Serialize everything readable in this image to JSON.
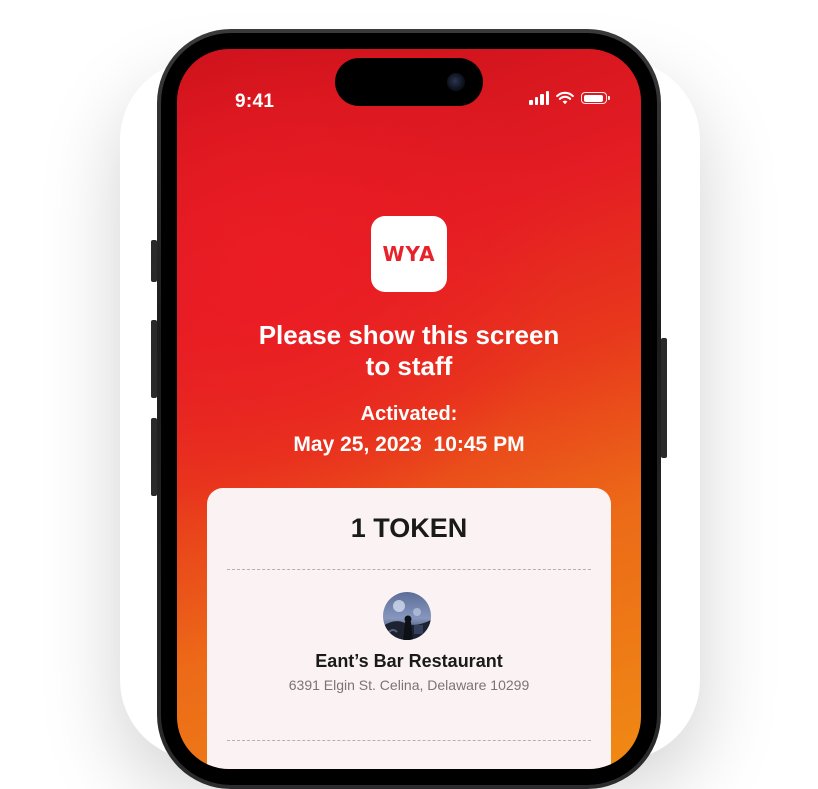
{
  "status_bar": {
    "time": "9:41",
    "signal_icon": "cellular-signal-icon",
    "wifi_icon": "wifi-icon",
    "battery_icon": "battery-icon"
  },
  "app": {
    "logo_text": "WYA",
    "brand_color": "#E8222A"
  },
  "main": {
    "heading_line1": "Please show this screen",
    "heading_line2": "to staff",
    "activated_label": "Activated:",
    "activated_date": "May 25, 2023  10:45 PM"
  },
  "card": {
    "token_label": "1 TOKEN",
    "venue_name": "Eant’s Bar Restaurant",
    "venue_address": "6391 Elgin St. Celina, Delaware 10299"
  }
}
